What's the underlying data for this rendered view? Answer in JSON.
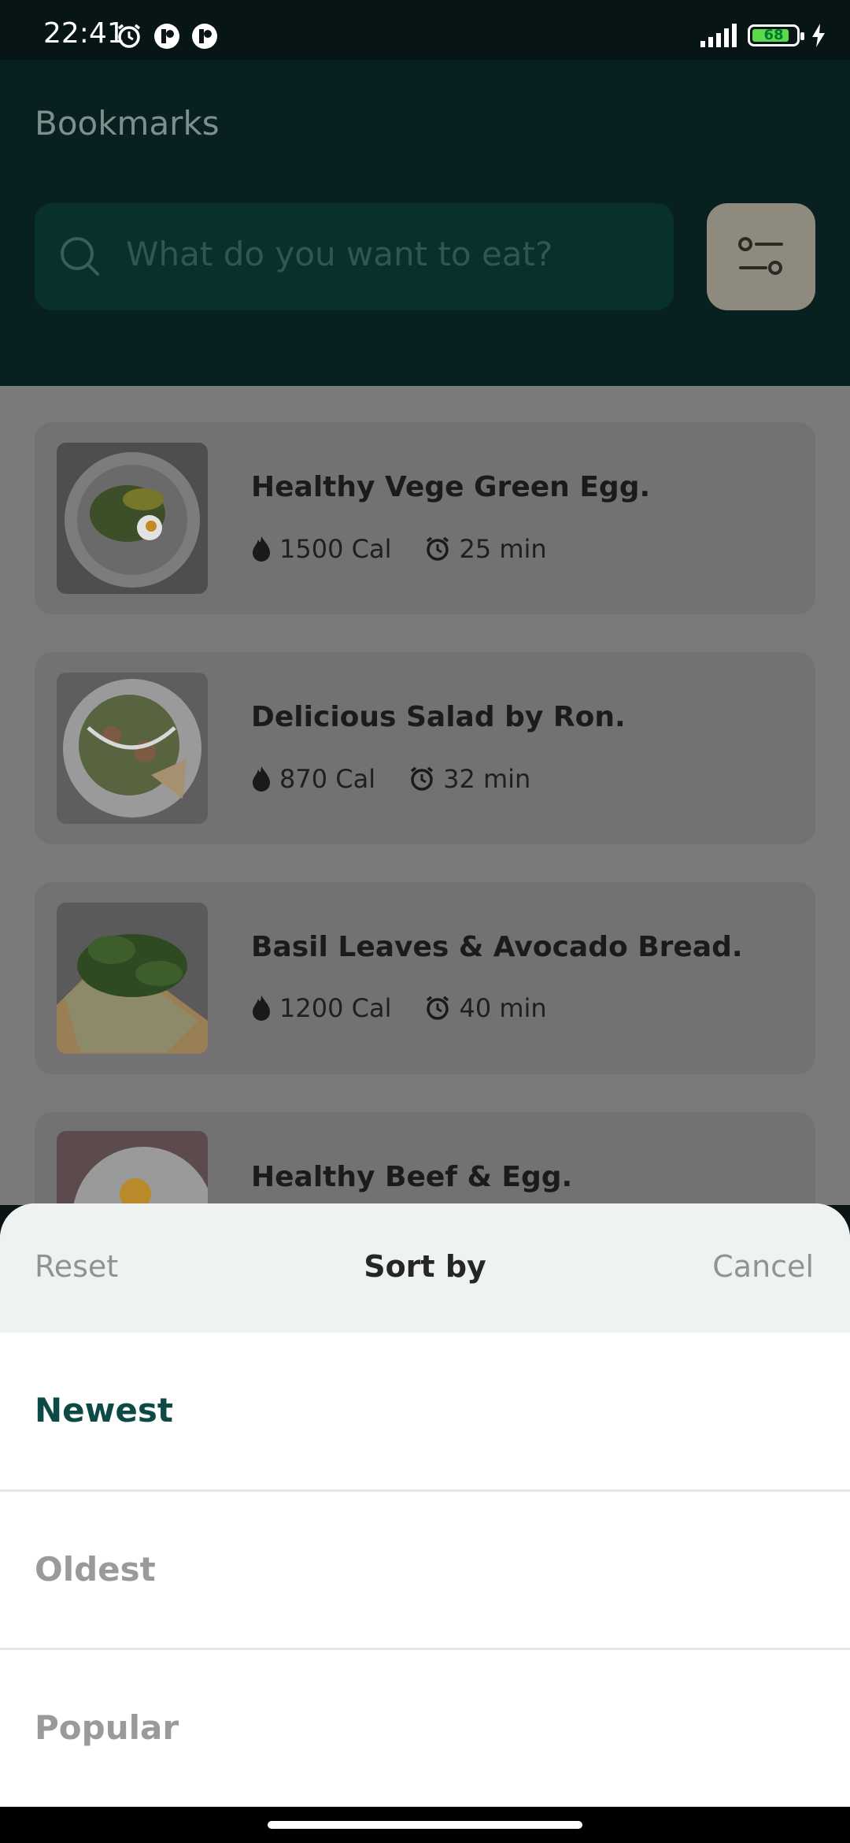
{
  "status_bar": {
    "time": "22:41",
    "battery": "68"
  },
  "header": {
    "title": "Bookmarks",
    "search_placeholder": "What do you want to eat?"
  },
  "recipes": [
    {
      "title": "Healthy Vege Green Egg.",
      "calories": "1500 Cal",
      "time": "25 min"
    },
    {
      "title": "Delicious Salad by Ron.",
      "calories": "870 Cal",
      "time": "32 min"
    },
    {
      "title": "Basil Leaves & Avocado Bread.",
      "calories": "1200 Cal",
      "time": "40 min"
    },
    {
      "title": "Healthy Beef & Egg."
    }
  ],
  "sheet": {
    "reset": "Reset",
    "title": "Sort by",
    "cancel": "Cancel",
    "options": [
      {
        "label": "Newest",
        "selected": true
      },
      {
        "label": "Oldest",
        "selected": false
      },
      {
        "label": "Popular",
        "selected": false
      }
    ]
  },
  "colors": {
    "header_bg": "#08201f",
    "accent": "#0d4a45",
    "option_inactive": "#9a9a9a"
  }
}
